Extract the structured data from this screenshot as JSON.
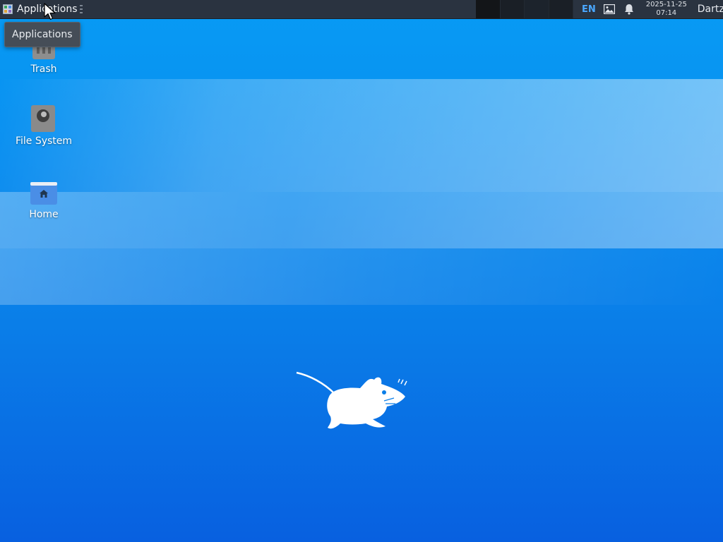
{
  "panel": {
    "applications_label": "Applications",
    "language": "EN",
    "clock_date": "2025-11-25",
    "clock_time": "07:14",
    "user": "Dartz",
    "icons": [
      "applications-menu-icon",
      "image-icon",
      "notification-bell-icon"
    ]
  },
  "tooltip": {
    "text": "Applications"
  },
  "desktop": {
    "icons": [
      {
        "name": "trash",
        "label": "Trash",
        "icon": "trash-icon"
      },
      {
        "name": "file-system",
        "label": "File System",
        "icon": "drive-icon"
      },
      {
        "name": "home",
        "label": "Home",
        "icon": "home-folder-icon"
      }
    ],
    "wallpaper": "xfce-mouse-logo"
  },
  "colors": {
    "panel_bg": "#2a3340",
    "desktop_top": "#079bf4",
    "desktop_bottom": "#0860e0",
    "language_accent": "#4aa8ff"
  }
}
